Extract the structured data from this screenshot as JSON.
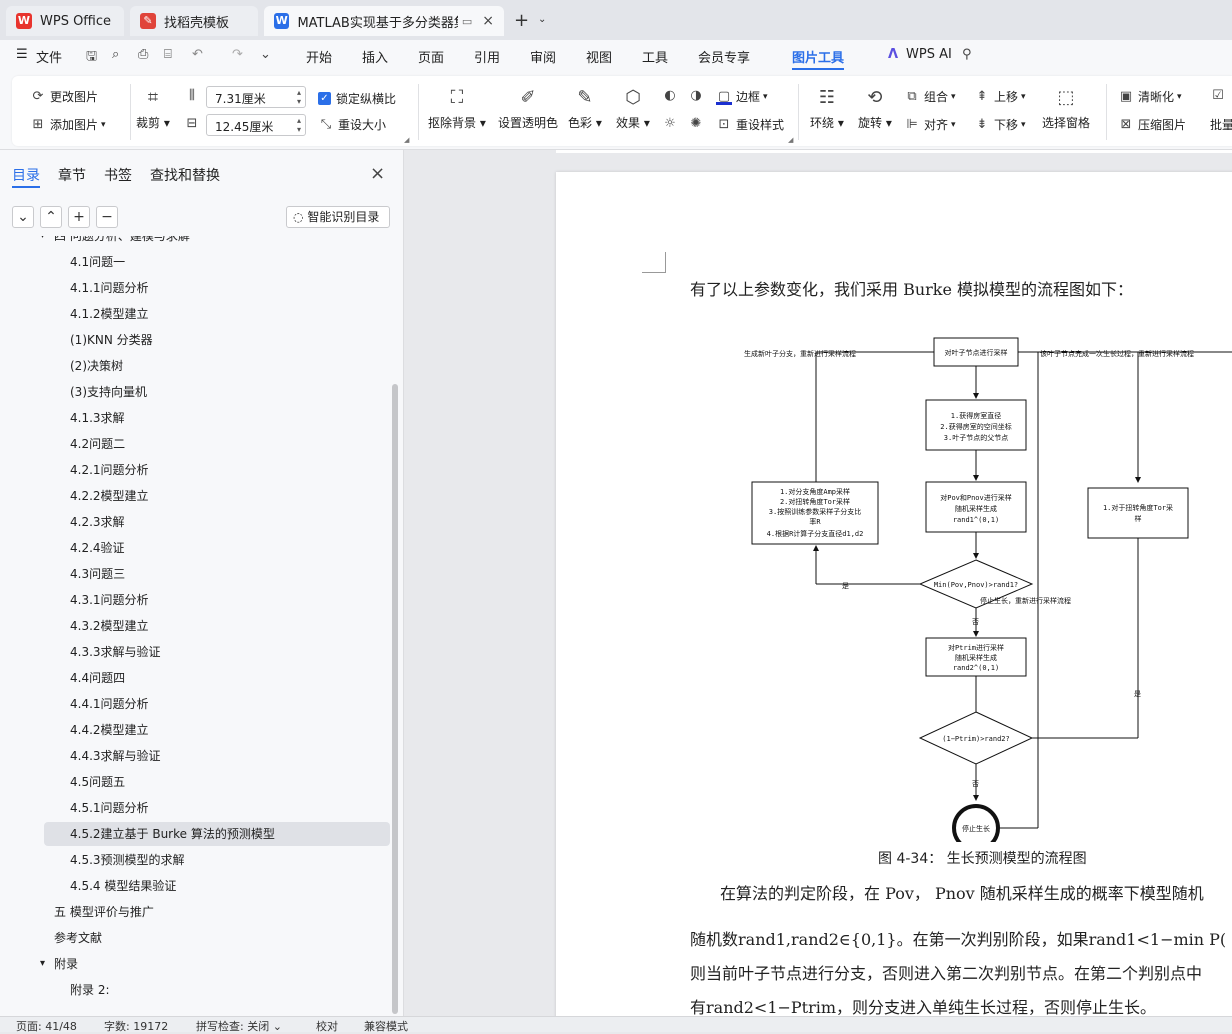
{
  "tabs": [
    {
      "label": "WPS Office"
    },
    {
      "label": "找稻壳模板"
    },
    {
      "label": "MATLAB实现基于多分类器集"
    }
  ],
  "menu": {
    "file": "文件",
    "items": [
      "开始",
      "插入",
      "页面",
      "引用",
      "审阅",
      "视图",
      "工具",
      "会员专享",
      "图片工具",
      "WPS AI"
    ]
  },
  "ribbon": {
    "change_image": "更改图片",
    "add_image": "添加图片",
    "crop": "裁剪",
    "height_value": "7.31厘米",
    "width_value": "12.45厘米",
    "lock_ratio": "锁定纵横比",
    "resize": "重设大小",
    "remove_bg": "抠除背景",
    "set_transparent": "设置透明色",
    "color": "色彩",
    "effect": "效果",
    "border": "边框",
    "reset_style": "重设样式",
    "wrap": "环绕",
    "rotate": "旋转",
    "group": "组合",
    "align": "对齐",
    "move_up": "上移",
    "move_down": "下移",
    "selection_pane": "选择窗格",
    "sharpen": "清晰化",
    "compress": "压缩图片",
    "batch": "批量处"
  },
  "sidebar": {
    "tabs": [
      "目录",
      "章节",
      "书签",
      "查找和替换"
    ],
    "smart_toc": "智能识别目录",
    "toc": [
      {
        "label": "四 问题分析、建模与求解",
        "level": 0,
        "arrow": "▾"
      },
      {
        "label": "4.1问题一",
        "level": 2
      },
      {
        "label": "4.1.1问题分析",
        "level": 2
      },
      {
        "label": "4.1.2模型建立",
        "level": 2
      },
      {
        "label": "(1)KNN 分类器",
        "level": 2
      },
      {
        "label": "(2)决策树",
        "level": 2
      },
      {
        "label": "(3)支持向量机",
        "level": 2
      },
      {
        "label": "4.1.3求解",
        "level": 2
      },
      {
        "label": "4.2问题二",
        "level": 2
      },
      {
        "label": "4.2.1问题分析",
        "level": 2
      },
      {
        "label": "4.2.2模型建立",
        "level": 2
      },
      {
        "label": "4.2.3求解",
        "level": 2
      },
      {
        "label": "4.2.4验证",
        "level": 2
      },
      {
        "label": "4.3问题三",
        "level": 2
      },
      {
        "label": "4.3.1问题分析",
        "level": 2
      },
      {
        "label": "4.3.2模型建立",
        "level": 2
      },
      {
        "label": "4.3.3求解与验证",
        "level": 2
      },
      {
        "label": "4.4问题四",
        "level": 2
      },
      {
        "label": "4.4.1问题分析",
        "level": 2
      },
      {
        "label": "4.4.2模型建立",
        "level": 2
      },
      {
        "label": "4.4.3求解与验证",
        "level": 2
      },
      {
        "label": "4.5问题五",
        "level": 2
      },
      {
        "label": "4.5.1问题分析",
        "level": 2
      },
      {
        "label": "4.5.2建立基于 Burke 算法的预测模型",
        "level": 2,
        "selected": true
      },
      {
        "label": "4.5.3预测模型的求解",
        "level": 2
      },
      {
        "label": "4.5.4 模型结果验证",
        "level": 2
      },
      {
        "label": "五 模型评价与推广",
        "level": 1
      },
      {
        "label": "参考文献",
        "level": 1
      },
      {
        "label": "附录",
        "level": 0,
        "arrow": "▾"
      },
      {
        "label": "附录 2:",
        "level": 2
      }
    ]
  },
  "doc": {
    "intro": "有了以上参数变化，我们采用 Burke 模拟模型的流程图如下：",
    "caption": "图 4-34： 生长预测模型的流程图",
    "p1": "在算法的判定阶段，在 Pov， Pnov 随机采样生成的概率下模型随机",
    "p2": "随机数rand1,rand2∈{0,1}。在第一次判别阶段，如果rand1<1−min P(",
    "p3": "则当前叶子节点进行分支，否则进入第二次判别节点。在第二个判别点中",
    "p4": "有rand2<1−Ptrim，则分支进入单纯生长过程，否则停止生长。",
    "flow": {
      "sample": "对叶子节点进行采样",
      "get1": "1.获得房室直径",
      "get2": "2.获得房室的空间坐标",
      "get3": "3.叶子节点的父节点",
      "pov1": "对Pov和Pnov进行采样",
      "pov2": "随机采样生成",
      "pov3": "rand1^(0,1)",
      "left1": "1.对分支角度Amp采样",
      "left2": "2.对扭转角度Tor采样",
      "left3": "3.按照训练参数采样子分支比",
      "left3b": "率R",
      "left4": "4.根据R计算子分支直径d1,d2",
      "right1": "1.对于扭转角度Tor采",
      "right1b": "样",
      "d1": "Min(Pov,Pnov)>rand1?",
      "ptrim1": "对Ptrim进行采样",
      "ptrim2": "随机采样生成",
      "ptrim3": "rand2^(0,1)",
      "d2": "(1−Ptrim)>rand2?",
      "stop": "停止生长",
      "gen_left": "生成新叶子分支，重新进行采样流程",
      "gen_right": "该叶子节点完成一次生长过程，重新进行采样流程",
      "stop_note": "停止生长，重新进行采样流程",
      "yes": "是",
      "no": "否"
    }
  },
  "status": {
    "page": "页面: 41/48",
    "words": "字数: 19172",
    "spell": "拼写检查: 关闭",
    "proof": "校对",
    "compat": "兼容模式"
  },
  "colors": {
    "accent": "#2b6fe8",
    "wps_red": "#e8342e"
  }
}
